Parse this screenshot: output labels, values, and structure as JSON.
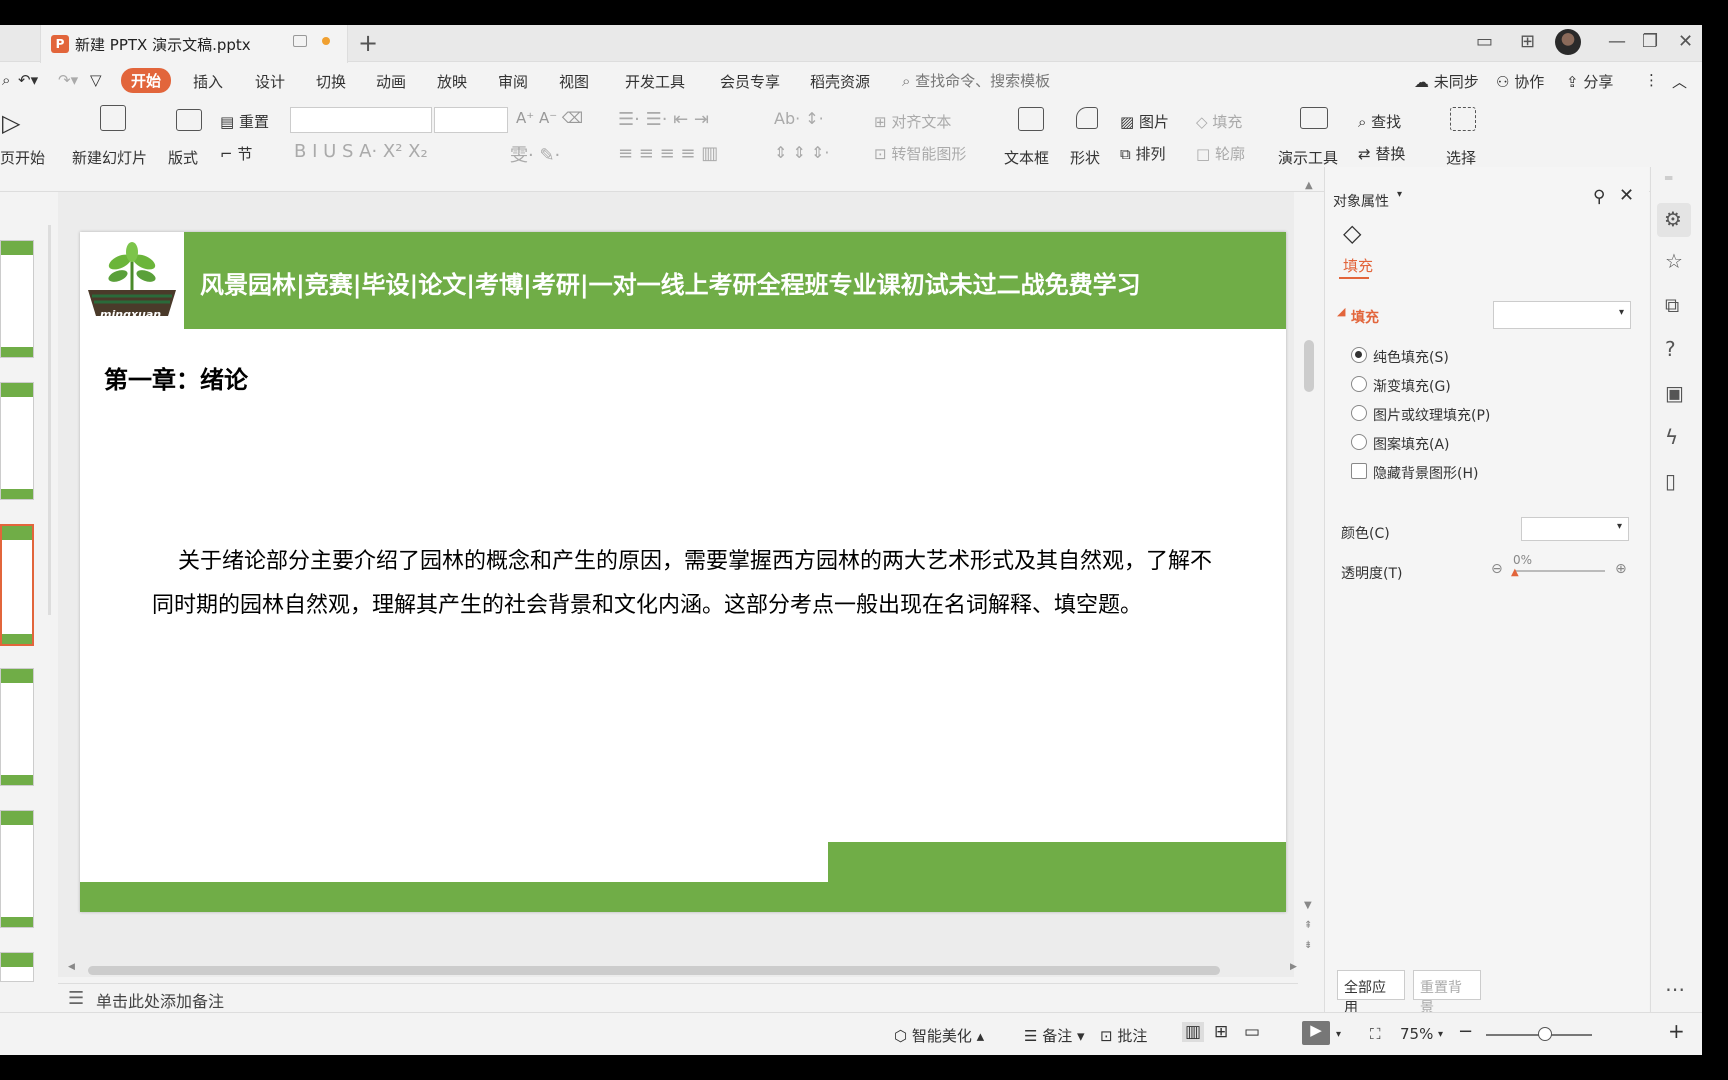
{
  "titlebar": {
    "doc_title": "新建 PPTX 演示文稿.pptx",
    "new_tab": "+"
  },
  "menu": {
    "items": [
      "开始",
      "插入",
      "设计",
      "切换",
      "动画",
      "放映",
      "审阅",
      "视图",
      "开发工具",
      "会员专享",
      "稻壳资源"
    ],
    "search": "查找命令、搜索模板",
    "sync": "未同步",
    "collab": "协作",
    "share": "分享"
  },
  "ribbon": {
    "from_start": "页开始",
    "new_slide": "新建幻灯片",
    "layout": "版式",
    "reset": "重置",
    "section": "节",
    "align_text": "对齐文本",
    "smart_art": "转智能图形",
    "textbox": "文本框",
    "shape": "形状",
    "picture": "图片",
    "arrange": "排列",
    "fill": "填充",
    "outline": "轮廓",
    "present_tools": "演示工具",
    "find": "查找",
    "replace": "替换",
    "select": "选择"
  },
  "slide": {
    "header_title": "风景园林|竞赛|毕设|论文|考博|考研|一对一线上考研全程班专业课初试未过二战免费学习",
    "logo_text": "mingxuan",
    "chapter": "第一章：绪论",
    "body": "关于绪论部分主要介绍了园林的概念和产生的原因，需要掌握西方园林的两大艺术形式及其自然观，了解不同时期的园林自然观，理解其产生的社会背景和文化内涵。这部分考点一般出现在名词解释、填空题。",
    "accent": "#70ad47"
  },
  "notes_placeholder": "单击此处添加备注",
  "panel": {
    "title": "对象属性",
    "tab_fill": "填充",
    "section_fill": "填充",
    "options": [
      "纯色填充(S)",
      "渐变填充(G)",
      "图片或纹理填充(P)",
      "图案填充(A)"
    ],
    "selected_option": "纯色填充(S)",
    "hide_bg": "隐藏背景图形(H)",
    "color_label": "颜色(C)",
    "transparency_label": "透明度(T)",
    "transparency_value": "0%",
    "apply_all": "全部应用",
    "reset_bg": "重置背景"
  },
  "status": {
    "beautify": "智能美化",
    "notes": "备注",
    "comment": "批注",
    "zoom": "75%"
  },
  "colors": {
    "brand": "#e2653b",
    "slide_green": "#70ad47"
  }
}
